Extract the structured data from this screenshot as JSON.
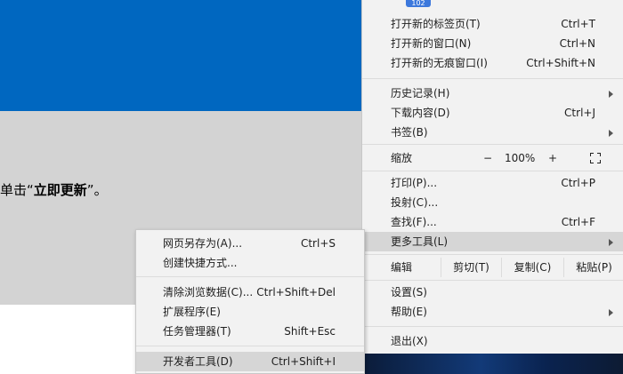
{
  "background": {
    "instruction_prefix": "单击“",
    "instruction_bold": "立即更新",
    "instruction_suffix": "”。"
  },
  "menu": {
    "badge": "102",
    "new_tab": {
      "label": "打开新的标签页(T)",
      "shortcut": "Ctrl+T"
    },
    "new_window": {
      "label": "打开新的窗口(N)",
      "shortcut": "Ctrl+N"
    },
    "incognito": {
      "label": "打开新的无痕窗口(I)",
      "shortcut": "Ctrl+Shift+N"
    },
    "history": {
      "label": "历史记录(H)"
    },
    "downloads": {
      "label": "下载内容(D)",
      "shortcut": "Ctrl+J"
    },
    "bookmarks": {
      "label": "书签(B)"
    },
    "zoom": {
      "label": "缩放",
      "minus": "−",
      "value": "100%",
      "plus": "+"
    },
    "print": {
      "label": "打印(P)...",
      "shortcut": "Ctrl+P"
    },
    "cast": {
      "label": "投射(C)..."
    },
    "find": {
      "label": "查找(F)...",
      "shortcut": "Ctrl+F"
    },
    "more_tools": {
      "label": "更多工具(L)"
    },
    "edit": {
      "label": "编辑",
      "cut": "剪切(T)",
      "copy": "复制(C)",
      "paste": "粘贴(P)"
    },
    "settings": {
      "label": "设置(S)"
    },
    "help": {
      "label": "帮助(E)"
    },
    "exit": {
      "label": "退出(X)"
    }
  },
  "submenu": {
    "save_as": {
      "label": "网页另存为(A)...",
      "shortcut": "Ctrl+S"
    },
    "create_shortcut": {
      "label": "创建快捷方式..."
    },
    "clear_data": {
      "label": "清除浏览数据(C)...",
      "shortcut": "Ctrl+Shift+Del"
    },
    "extensions": {
      "label": "扩展程序(E)"
    },
    "task_manager": {
      "label": "任务管理器(T)",
      "shortcut": "Shift+Esc"
    },
    "dev_tools": {
      "label": "开发者工具(D)",
      "shortcut": "Ctrl+Shift+I"
    }
  }
}
